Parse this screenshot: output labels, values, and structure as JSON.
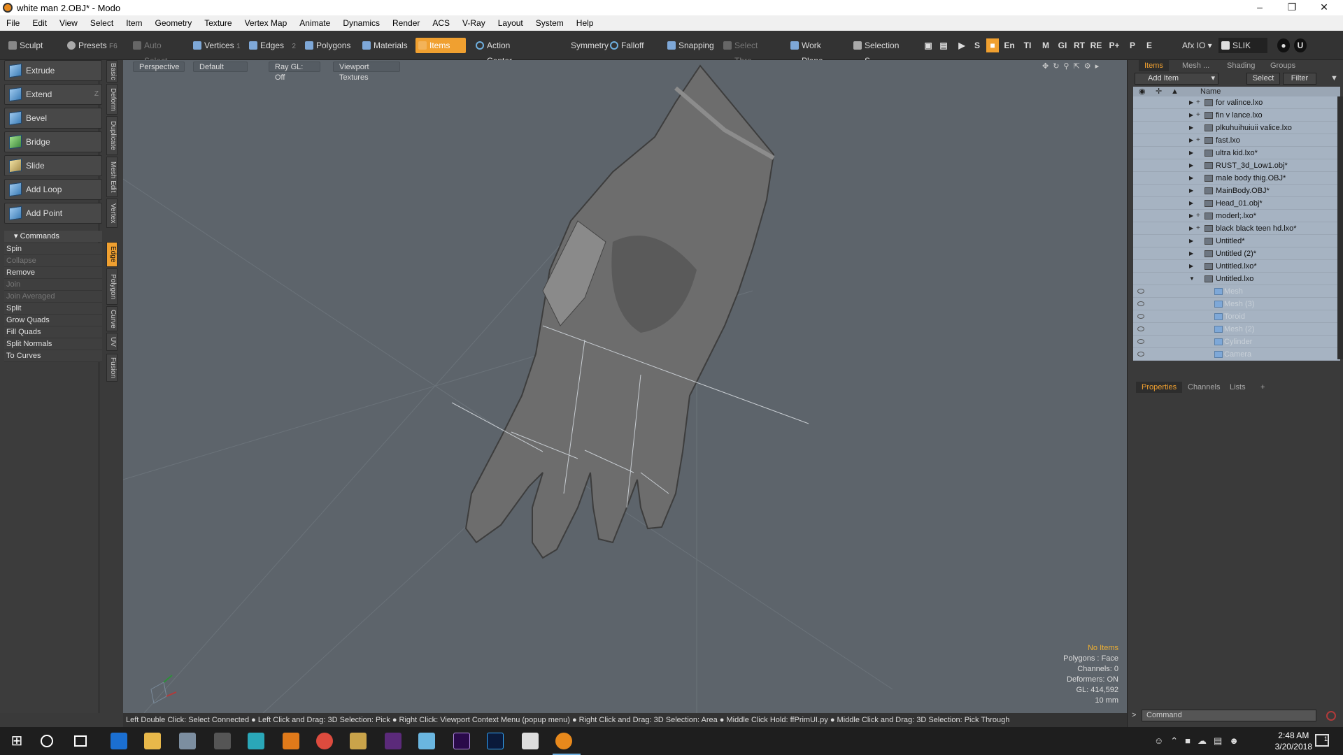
{
  "window": {
    "title": "white man 2.OBJ* - Modo",
    "minimize": "–",
    "maximize": "❐",
    "close": "✕"
  },
  "menu": [
    "File",
    "Edit",
    "View",
    "Select",
    "Item",
    "Geometry",
    "Texture",
    "Vertex Map",
    "Animate",
    "Dynamics",
    "Render",
    "ACS",
    "V-Ray",
    "Layout",
    "System",
    "Help"
  ],
  "toolbar": {
    "sculpt": "Sculpt",
    "presets": "Presets",
    "presets_key": "F6",
    "auto_select": "Auto Select",
    "vertices": "Vertices",
    "vertices_key": "1",
    "edges": "Edges",
    "edges_key": "2",
    "polygons": "Polygons",
    "materials": "Materials",
    "items": "Items",
    "action_center": "Action Center",
    "symmetry": "Symmetry",
    "falloff": "Falloff",
    "snapping": "Snapping",
    "select_through": "Select Thro...",
    "work_plane": "Work Plane",
    "selection_sets": "Selection S...",
    "afx": "Afx IO",
    "slik": "SLIK",
    "small_buttons": [
      "S",
      "En",
      "TI",
      "M",
      "GI",
      "RT",
      "RE",
      "P+",
      "P",
      "E"
    ]
  },
  "left_tools": [
    {
      "label": "Extrude",
      "key": ""
    },
    {
      "label": "Extend",
      "key": "Z"
    },
    {
      "label": "Bevel",
      "key": ""
    },
    {
      "label": "Bridge",
      "key": ""
    },
    {
      "label": "Slide",
      "key": ""
    },
    {
      "label": "Add Loop",
      "key": ""
    },
    {
      "label": "Add Point",
      "key": ""
    }
  ],
  "vertical_tabs": [
    "Basic",
    "Deform",
    "Duplicate",
    "Mesh Edit",
    "Vertex",
    "Edge",
    "Polygon",
    "Curve",
    "UV",
    "Fusion"
  ],
  "commands": {
    "header": "Commands",
    "items": [
      {
        "label": "Spin",
        "enabled": true
      },
      {
        "label": "Collapse",
        "enabled": false
      },
      {
        "label": "Remove",
        "enabled": true
      },
      {
        "label": "Join",
        "enabled": false
      },
      {
        "label": "Join Averaged",
        "enabled": false
      },
      {
        "label": "Split",
        "enabled": true
      },
      {
        "label": "Grow Quads",
        "enabled": true
      },
      {
        "label": "Fill Quads",
        "enabled": true
      },
      {
        "label": "Split Normals",
        "enabled": true
      },
      {
        "label": "To Curves",
        "enabled": true
      }
    ]
  },
  "viewport": {
    "view": "Perspective",
    "style": "Default",
    "raygl": "Ray GL: Off",
    "textures": "Viewport Textures",
    "hud": {
      "items": "No Items",
      "polygons": "Polygons : Face",
      "channels": "Channels: 0",
      "deformers": "Deformers: ON",
      "gl": "GL: 414,592",
      "scale": "10 mm"
    }
  },
  "status": "Left Double Click: Select Connected ● Left Click and Drag: 3D Selection: Pick ● Right Click: Viewport Context Menu (popup menu) ● Right Click and Drag: 3D Selection: Area ● Middle Click Hold: ffPrimUI.py ● Middle Click and Drag: 3D Selection: Pick Through",
  "right_panel": {
    "tabs": [
      "Items",
      "Mesh ...",
      "Shading",
      "Groups"
    ],
    "add_item": "Add Item",
    "select": "Select",
    "filter": "Filter",
    "name_header": "Name",
    "items": [
      {
        "name": "for valince.lxo",
        "child": false,
        "expanded": false,
        "plus": true
      },
      {
        "name": "fin v lance.lxo",
        "child": false,
        "expanded": false,
        "plus": true
      },
      {
        "name": "plkuhuihuiuii valice.lxo",
        "child": false,
        "expanded": false,
        "plus": false
      },
      {
        "name": "fast.lxo",
        "child": false,
        "expanded": false,
        "plus": true
      },
      {
        "name": "ultra kid.lxo*",
        "child": false,
        "expanded": false,
        "plus": false
      },
      {
        "name": "RUST_3d_Low1.obj*",
        "child": false,
        "expanded": false,
        "plus": false
      },
      {
        "name": "male body thig.OBJ*",
        "child": false,
        "expanded": false,
        "plus": false
      },
      {
        "name": "MainBody.OBJ*",
        "child": false,
        "expanded": false,
        "plus": false
      },
      {
        "name": "Head_01.obj*",
        "child": false,
        "expanded": false,
        "plus": false
      },
      {
        "name": "moderl;.lxo*",
        "child": false,
        "expanded": false,
        "plus": true
      },
      {
        "name": "black black teen hd.lxo*",
        "child": false,
        "expanded": false,
        "plus": true
      },
      {
        "name": "Untitled*",
        "child": false,
        "expanded": false,
        "plus": false
      },
      {
        "name": "Untitled (2)*",
        "child": false,
        "expanded": false,
        "plus": false
      },
      {
        "name": "Untitled.lxo*",
        "child": false,
        "expanded": false,
        "plus": false
      },
      {
        "name": "Untitled.lxo",
        "child": false,
        "expanded": true,
        "plus": false
      },
      {
        "name": "Mesh",
        "child": true
      },
      {
        "name": "Mesh (3)",
        "child": true
      },
      {
        "name": "Toroid",
        "child": true
      },
      {
        "name": "Mesh (2)",
        "child": true
      },
      {
        "name": "Cylinder",
        "child": true
      },
      {
        "name": "Camera",
        "child": true
      }
    ],
    "lower_tabs": [
      "Properties",
      "Channels",
      "Lists"
    ],
    "command_placeholder": "Command"
  },
  "taskbar": {
    "time": "2:48 AM",
    "date": "3/20/2018",
    "notif": "1"
  },
  "colors": {
    "accent": "#f0a030",
    "viewport": "#5d646b",
    "tree_row": "#a6b3c2"
  }
}
